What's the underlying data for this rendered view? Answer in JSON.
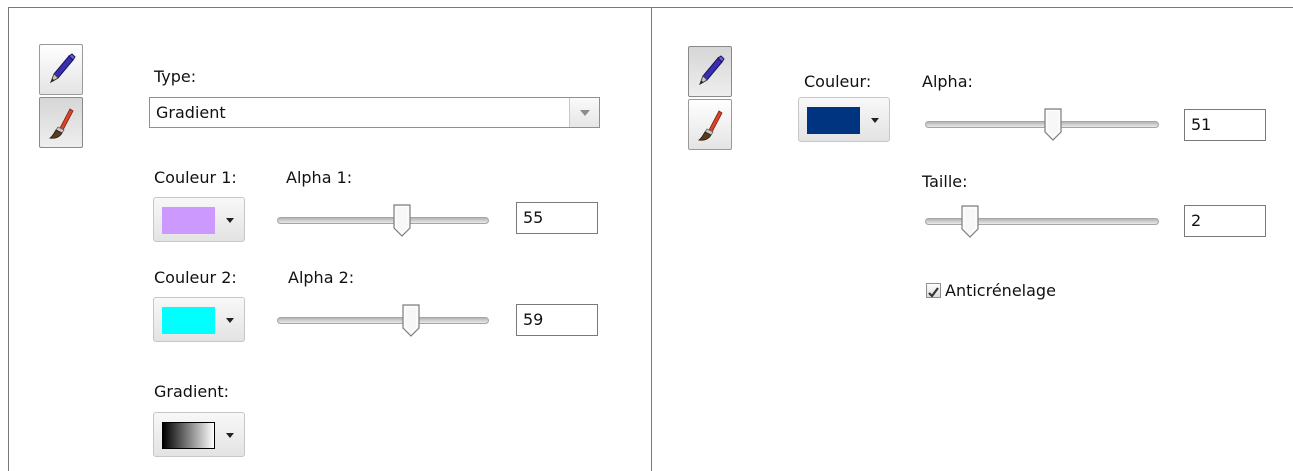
{
  "left": {
    "type_label": "Type:",
    "type_value": "Gradient",
    "color1_label": "Couleur 1:",
    "alpha1_label": "Alpha 1:",
    "alpha1_value": "55",
    "color1_swatch": "#cc99ff",
    "color2_label": "Couleur 2:",
    "alpha2_label": "Alpha 2:",
    "alpha2_value": "59",
    "color2_swatch": "#00ffff",
    "gradient_label": "Gradient:"
  },
  "right": {
    "color_label": "Couleur:",
    "color_swatch": "#003380",
    "alpha_label": "Alpha:",
    "alpha_value": "51",
    "size_label": "Taille:",
    "size_value": "2",
    "antialias_label": "Anticrénelage",
    "antialias_checked": true
  },
  "icons": {
    "pen": "pen-icon",
    "brush": "paintbrush-icon"
  }
}
